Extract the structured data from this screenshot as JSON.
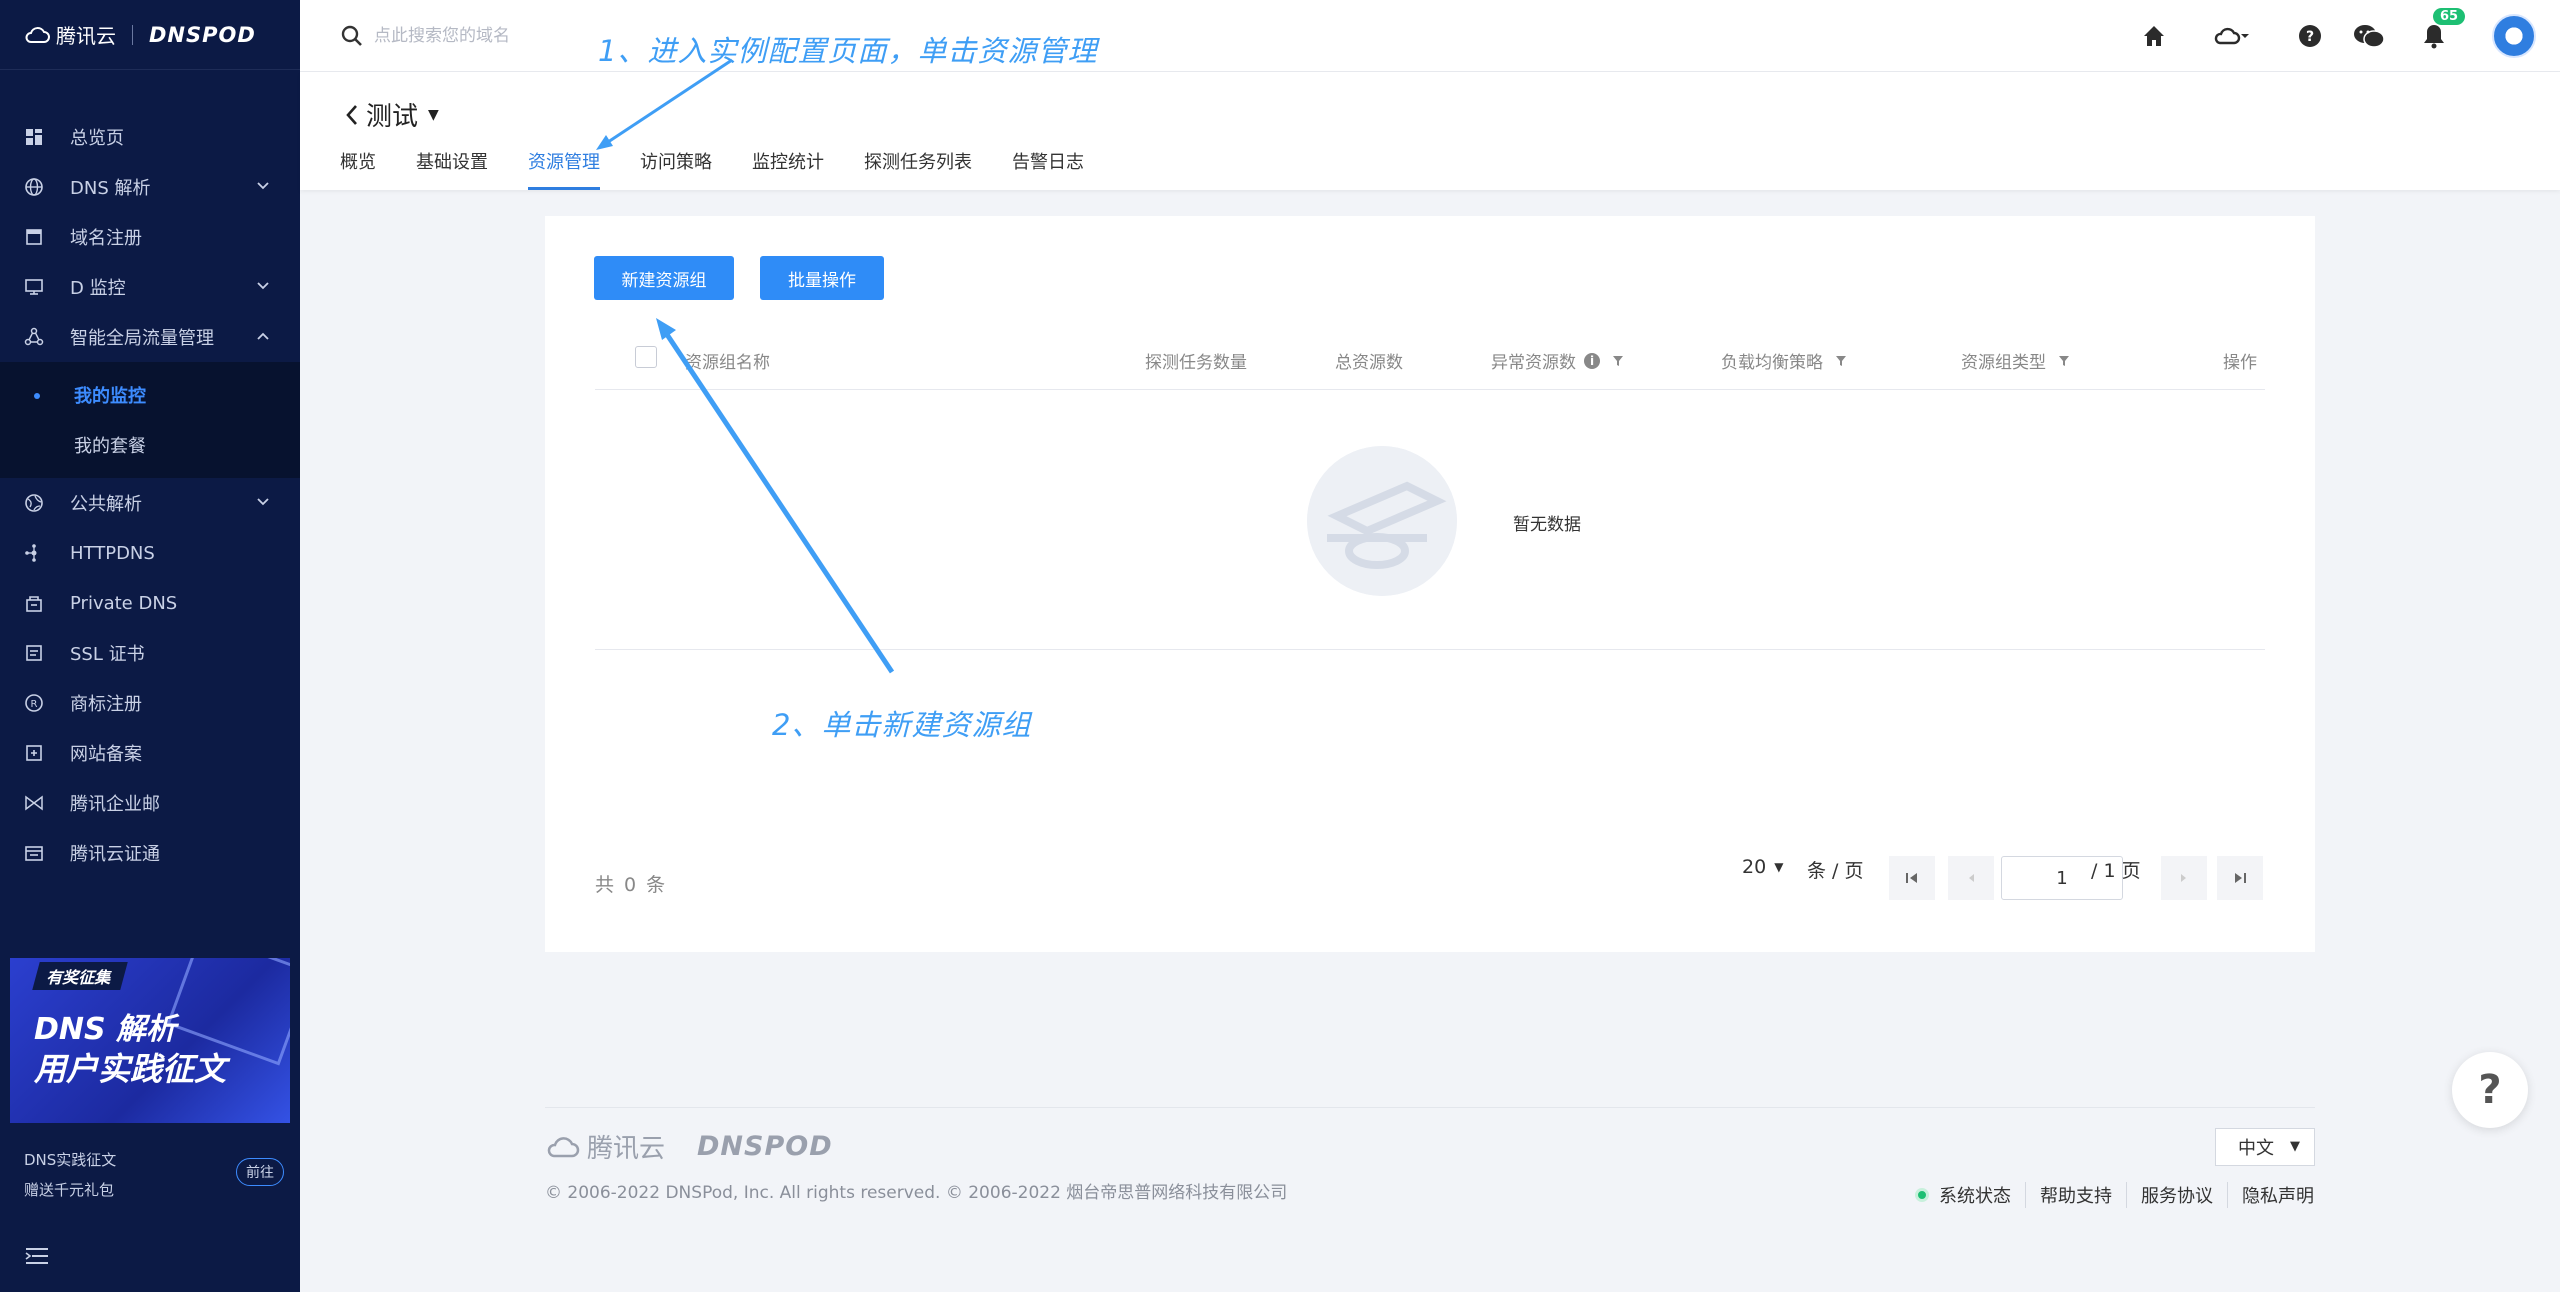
{
  "brand": {
    "tencent": "腾讯云",
    "dnspod": "DNSPOD"
  },
  "search": {
    "placeholder": "点此搜索您的域名"
  },
  "topbar": {
    "notification_count": "65"
  },
  "sidebar": {
    "items": [
      {
        "label": "总览页",
        "icon": "dashboard-icon"
      },
      {
        "label": "DNS 解析",
        "icon": "globe-icon"
      },
      {
        "label": "域名注册",
        "icon": "calendar-icon"
      },
      {
        "label": "D 监控",
        "icon": "monitor-icon"
      },
      {
        "label": "智能全局流量管理",
        "icon": "traffic-icon"
      },
      {
        "label": "我的监控"
      },
      {
        "label": "我的套餐"
      },
      {
        "label": "公共解析",
        "icon": "globe-alt-icon"
      },
      {
        "label": "HTTPDNS",
        "icon": "network-icon"
      },
      {
        "label": "Private DNS",
        "icon": "private-icon"
      },
      {
        "label": "SSL 证书",
        "icon": "certificate-icon"
      },
      {
        "label": "商标注册",
        "icon": "trademark-icon"
      },
      {
        "label": "网站备案",
        "icon": "filing-icon"
      },
      {
        "label": "腾讯企业邮",
        "icon": "mail-icon"
      },
      {
        "label": "腾讯云证通",
        "icon": "id-icon"
      }
    ],
    "banner": {
      "tag": "有奖征集",
      "line1": "DNS 解析",
      "line2": "用户实践征文"
    },
    "promo": {
      "line1": "DNS实践征文",
      "line2": "赠送千元礼包",
      "button": "前往"
    }
  },
  "header": {
    "title": "测试",
    "tabs": [
      "概览",
      "基础设置",
      "资源管理",
      "访问策略",
      "监控统计",
      "探测任务列表",
      "告警日志"
    ]
  },
  "toolbar": {
    "create_label": "新建资源组",
    "batch_label": "批量操作"
  },
  "table": {
    "columns": [
      "资源组名称",
      "探测任务数量",
      "总资源数",
      "异常资源数",
      "负载均衡策略",
      "资源组类型",
      "操作"
    ],
    "empty_text": "暂无数据"
  },
  "pagination": {
    "total": "共 0 条",
    "page_size": "20",
    "per_page": "条 / 页",
    "current": "1",
    "of_pages": "/ 1 页"
  },
  "annotations": {
    "step1": "1、进入实例配置页面，单击资源管理",
    "step2": "2、单击新建资源组"
  },
  "footer": {
    "copyright": "© 2006-2022 DNSPod, Inc. All rights reserved. © 2006-2022 烟台帝思普网络科技有限公司",
    "lang": "中文",
    "links": [
      "系统状态",
      "帮助支持",
      "服务协议",
      "隐私声明"
    ]
  },
  "help_fab": "?",
  "colors": {
    "sidebar_bg": "#0c1a45",
    "accent": "#2f7ee0",
    "annotation": "#3f9ef5",
    "status_ok": "#1dbf73"
  }
}
